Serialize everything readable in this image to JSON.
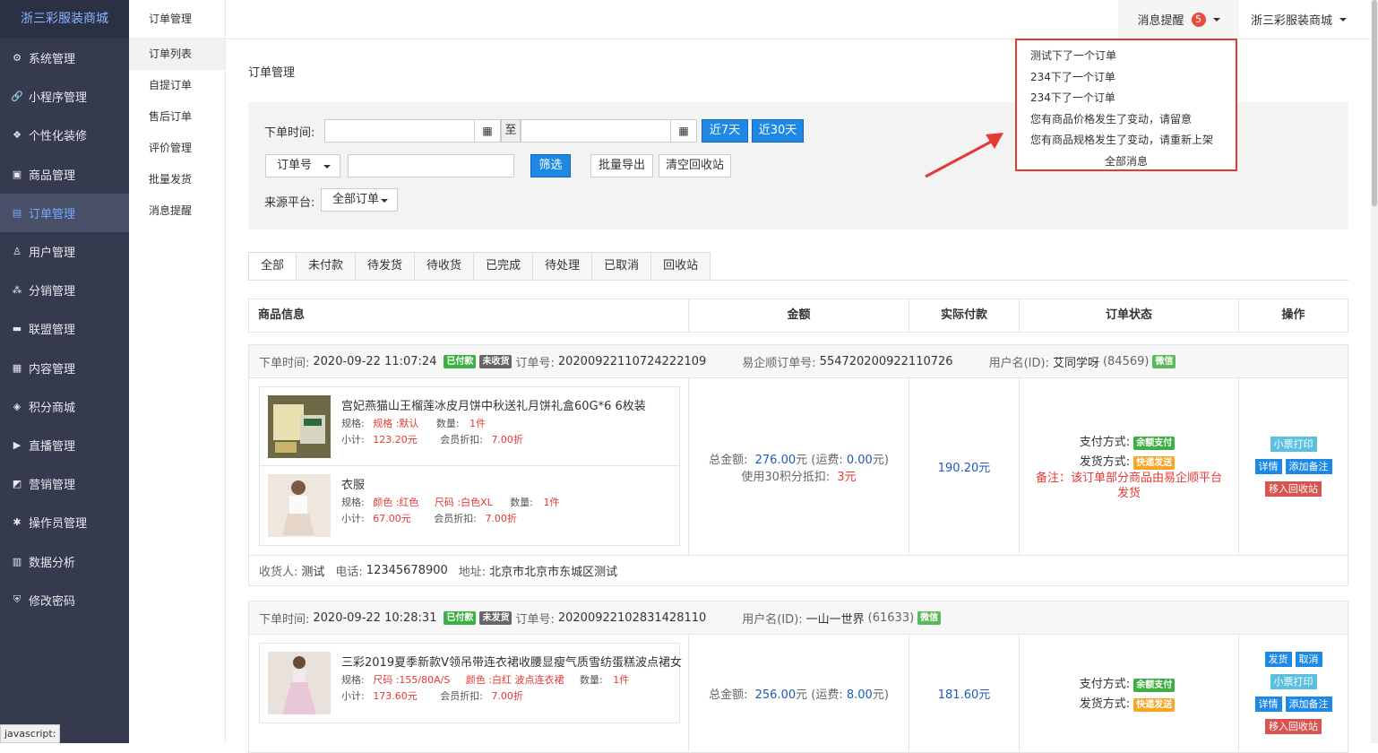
{
  "brand": "浙三彩服装商城",
  "sidebar": {
    "items": [
      {
        "label": "系统管理",
        "icon": "gear-icon",
        "glyph": "⚙"
      },
      {
        "label": "小程序管理",
        "icon": "link-icon",
        "glyph": "🔗"
      },
      {
        "label": "个性化装修",
        "icon": "diamond-icon",
        "glyph": "❖"
      },
      {
        "label": "商品管理",
        "icon": "bag-icon",
        "glyph": "▣"
      },
      {
        "label": "订单管理",
        "icon": "list-icon",
        "glyph": "▤"
      },
      {
        "label": "用户管理",
        "icon": "user-icon",
        "glyph": "♙"
      },
      {
        "label": "分销管理",
        "icon": "network-icon",
        "glyph": "⁂"
      },
      {
        "label": "联盟管理",
        "icon": "card-icon",
        "glyph": "▬"
      },
      {
        "label": "内容管理",
        "icon": "document-icon",
        "glyph": "▦"
      },
      {
        "label": "积分商城",
        "icon": "cube-icon",
        "glyph": "◈"
      },
      {
        "label": "直播管理",
        "icon": "play-icon",
        "glyph": "▶"
      },
      {
        "label": "营销管理",
        "icon": "megaphone-icon",
        "glyph": "◩"
      },
      {
        "label": "操作员管理",
        "icon": "cog-icon",
        "glyph": "✱"
      },
      {
        "label": "数据分析",
        "icon": "bar-chart-icon",
        "glyph": "▥"
      },
      {
        "label": "修改密码",
        "icon": "shield-icon",
        "glyph": "⛨"
      }
    ]
  },
  "subnav": {
    "title": "订单管理",
    "items": [
      "订单列表",
      "自提订单",
      "售后订单",
      "评价管理",
      "批量发货",
      "消息提醒"
    ]
  },
  "topbar": {
    "msg_label": "消息提醒",
    "msg_count": "5",
    "shop_label": "浙三彩服装商城"
  },
  "dropdown": {
    "items": [
      "测试下了一个订单",
      "234下了一个订单",
      "234下了一个订单",
      "您有商品价格发生了变动，请留意",
      "您有商品规格发生了变动，请重新上架"
    ],
    "all": "全部消息"
  },
  "page_title": "订单管理",
  "filter": {
    "time_label": "下单时间:",
    "to_label": "至",
    "btn_7d": "近7天",
    "btn_30d": "近30天",
    "order_no_select": "订单号",
    "btn_filter": "筛选",
    "btn_export": "批量导出",
    "btn_clear": "清空回收站",
    "source_label": "来源平台:",
    "source_select": "全部订单"
  },
  "tabs": [
    "全部",
    "未付款",
    "待发货",
    "待收货",
    "已完成",
    "待处理",
    "已取消",
    "回收站"
  ],
  "table_header": [
    "商品信息",
    "金额",
    "实际付款",
    "订单状态",
    "操作"
  ],
  "orders": [
    {
      "time_label": "下单时间:",
      "time": "2020-09-22 11:07:24",
      "tag_paid": "已付款",
      "tag_ship": "未收货",
      "no_label": "订单号:",
      "no": "20200922110724222109",
      "yq_label": "易企顺订单号:",
      "yq_no": "554720200922110726",
      "user_label": "用户名(ID):",
      "user": "艾同学呀",
      "user_id": "(84569)",
      "wx": "微信",
      "goods": [
        {
          "title": "宫妃燕猫山王榴莲冰皮月饼中秋送礼月饼礼盒60G*6 6枚装",
          "spec_label": "规格:",
          "spec": "规格 :默认",
          "qty_label": "数量:",
          "qty": "1件",
          "sub_label": "小计:",
          "sub": "123.20元",
          "disc_label": "会员折扣:",
          "disc": "7.00折"
        },
        {
          "title": "衣服",
          "spec_label": "规格:",
          "spec": "颜色 :红色",
          "spec2": "尺码 :白色XL",
          "qty_label": "数量:",
          "qty": "1件",
          "sub_label": "小计:",
          "sub": "67.00元",
          "disc_label": "会员折扣:",
          "disc": "7.00折"
        }
      ],
      "amount_label": "总金额:",
      "amount": "276.00",
      "freight_label": "元 (运费:",
      "freight": "0.00",
      "freight_tail": "元)",
      "points_text": "使用30积分抵扣:",
      "points_value": "3元",
      "paid": "190.20元",
      "pay_label": "支付方式:",
      "pay_tag": "余额支付",
      "ship_label": "发货方式:",
      "ship_tag": "快递发送",
      "remark": "备注：该订单部分商品由易企顺平台发货",
      "ops": [
        "小票打印",
        "详情",
        "添加备注",
        "移入回收站"
      ],
      "consignee_label": "收货人:",
      "consignee": "测试",
      "phone_label": "电话:",
      "phone": "12345678900",
      "addr_label": "地址:",
      "addr": "北京市北京市东城区测试"
    },
    {
      "time_label": "下单时间:",
      "time": "2020-09-22 10:28:31",
      "tag_paid": "已付款",
      "tag_ship": "未发货",
      "no_label": "订单号:",
      "no": "20200922102831428110",
      "user_label": "用户名(ID):",
      "user": "一山一世界",
      "user_id": "(61633)",
      "wx": "微信",
      "goods": [
        {
          "title": "三彩2019夏季新款V领吊带连衣裙收腰显瘦气质雪纺蛋糕波点裙女",
          "spec_label": "规格:",
          "spec": "尺码 :155/80A/S",
          "spec2": "颜色 :白红 波点连衣裙",
          "qty_label": "数量:",
          "qty": "1件",
          "sub_label": "小计:",
          "sub": "173.60元",
          "disc_label": "会员折扣:",
          "disc": "7.00折"
        }
      ],
      "amount_label": "总金额:",
      "amount": "256.00",
      "freight_label": "元 (运费:",
      "freight": "8.00",
      "freight_tail": "元)",
      "paid": "181.60元",
      "pay_label": "支付方式:",
      "pay_tag": "余额支付",
      "ship_label": "发货方式:",
      "ship_tag": "快递发送",
      "ops": [
        "发货",
        "取消",
        "小票打印",
        "详情",
        "添加备注",
        "移入回收站"
      ]
    }
  ],
  "status_bar": "javascript:",
  "colors": {
    "sidebar_bg": "#353a4e",
    "accent": "#1e88e5",
    "highlight_border": "#e53935"
  }
}
